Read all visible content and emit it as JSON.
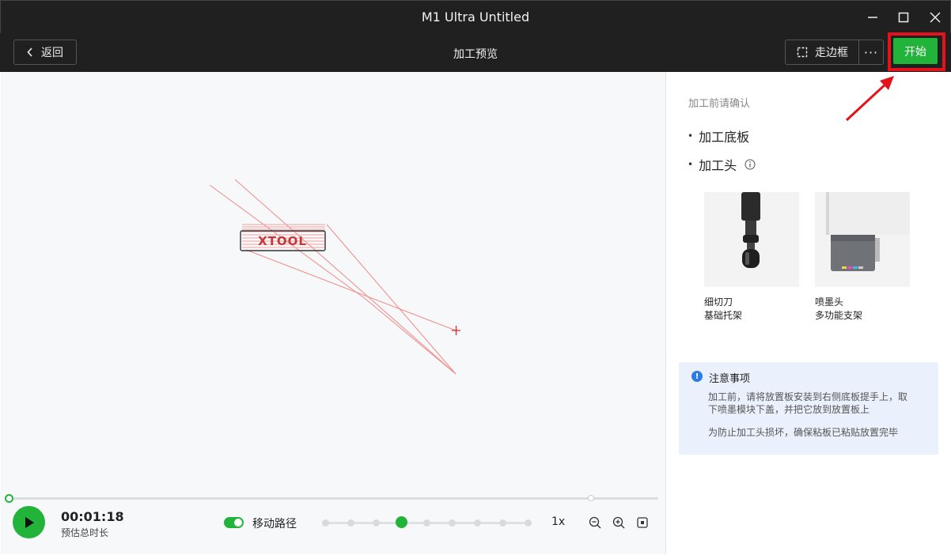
{
  "window": {
    "title": "M1 Ultra Untitled"
  },
  "toolbar": {
    "back_label": "返回",
    "page_title": "加工预览",
    "frame_label": "走边框",
    "more_label": "···",
    "start_label": "开始"
  },
  "canvas": {
    "logo_text": "XTOOL"
  },
  "player": {
    "estimated_time": "00:01:18",
    "estimated_time_label": "预估总时长",
    "move_path_label": "移动路径",
    "move_path_enabled": true,
    "speed_steps": 9,
    "speed_selected_index": 3,
    "speed_label": "1x",
    "progress": 0
  },
  "sidebar": {
    "confirm_title": "加工前请确认",
    "items": [
      {
        "label": "加工底板"
      },
      {
        "label": "加工头"
      }
    ],
    "heads": [
      {
        "name": "细切刀",
        "desc": "基础托架"
      },
      {
        "name": "喷墨头",
        "desc": "多功能支架"
      }
    ],
    "notice": {
      "title": "注意事项",
      "line1": "加工前，请将放置板安装到右侧底板提手上，取下喷墨模块下盖，并把它放到放置板上",
      "line2": "为防止加工头损坏，确保粘板已粘贴放置完毕"
    }
  },
  "colors": {
    "accent_green": "#22b33a",
    "highlight_red": "#e5121b",
    "toolbar_bg": "#202020",
    "notice_bg": "#eaf1fc",
    "path_red": "#f08a8a"
  }
}
